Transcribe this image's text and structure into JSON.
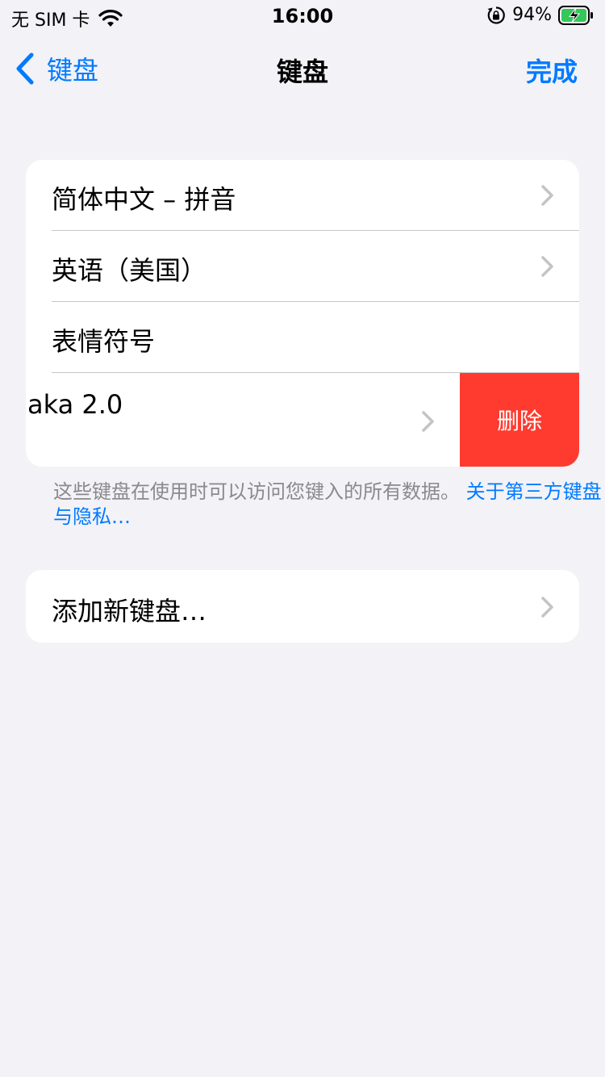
{
  "status_bar": {
    "carrier": "无 SIM 卡",
    "time": "16:00",
    "battery": "94%"
  },
  "nav": {
    "back_label": "键盘",
    "title": "键盘",
    "done_label": "完成"
  },
  "keyboards": [
    {
      "label": "简体中文 – 拼音",
      "has_chevron": true
    },
    {
      "label": "英语（美国）",
      "has_chevron": true
    },
    {
      "label": "表情符号",
      "has_chevron": false
    },
    {
      "label": "aka 2.0",
      "has_chevron": true
    }
  ],
  "delete_label": "删除",
  "footer": {
    "text": "这些键盘在使用时可以访问您键入的所有数据。",
    "link": "关于第三方键盘与隐私…"
  },
  "add_keyboard_label": "添加新键盘…",
  "colors": {
    "accent": "#007aff",
    "destructive": "#ff3b30",
    "background": "#f2f2f7",
    "battery_charging": "#34c759"
  },
  "icons": [
    "wifi-icon",
    "orientation-lock-icon",
    "battery-charging-icon",
    "back-chevron-icon",
    "chevron-right-icon"
  ]
}
